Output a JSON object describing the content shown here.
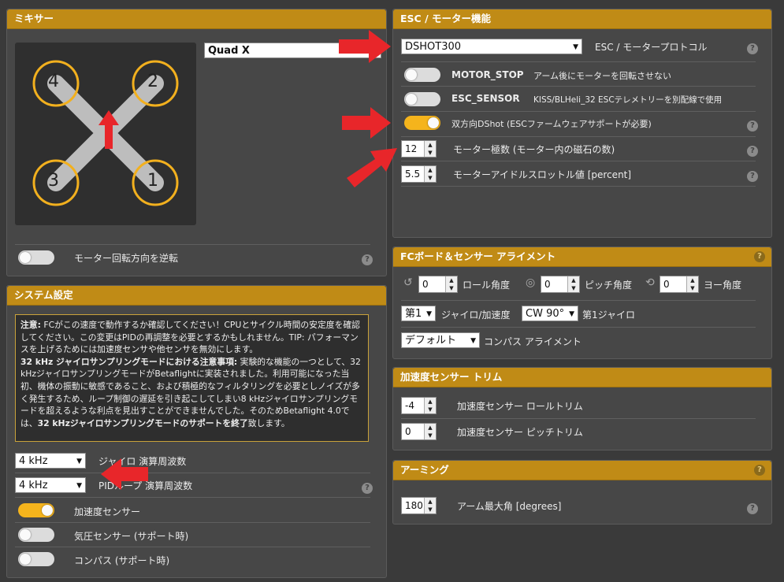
{
  "mixer": {
    "title": "ミキサー",
    "type": "Quad X",
    "reverse_label": "モーター回転方向を逆転",
    "motors": [
      "4",
      "2",
      "3",
      "1"
    ]
  },
  "esc": {
    "title": "ESC / モーター機能",
    "protocol": "DSHOT300",
    "protocol_label": "ESC / モータープロトコル",
    "motor_stop_name": "MOTOR_STOP",
    "motor_stop_desc": "アーム後にモーターを回転させない",
    "esc_sensor_name": "ESC_SENSOR",
    "esc_sensor_desc": "KISS/BLHeli_32 ESCテレメトリーを別配線で使用",
    "bidir_label": "双方向DShot (ESCファームウェアサポートが必要)",
    "poles_value": "12",
    "poles_label": "モーター極数 (モーター内の磁石の数)",
    "idle_value": "5.5",
    "idle_label": "モーターアイドルスロットル値 [percent]"
  },
  "align": {
    "title": "FCボード＆センサー アライメント",
    "roll_value": "0",
    "roll_label": "ロール角度",
    "pitch_value": "0",
    "pitch_label": "ピッチ角度",
    "yaw_value": "0",
    "yaw_label": "ヨー角度",
    "gyro_sel": "第1",
    "gyro_label": "ジャイロ/加速度",
    "gyro_align": "CW 90°",
    "gyro_name": "第1ジャイロ",
    "compass_sel": "デフォルト",
    "compass_label": "コンパス アライメント"
  },
  "acc_trim": {
    "title": "加速度センサー トリム",
    "roll_value": "-4",
    "roll_label": "加速度センサー ロールトリム",
    "pitch_value": "0",
    "pitch_label": "加速度センサー ピッチトリム"
  },
  "arming": {
    "title": "アーミング",
    "angle_value": "180",
    "angle_label": "アーム最大角 [degrees]"
  },
  "system": {
    "title": "システム設定",
    "warn1_head": "注意:",
    "warn1": " FCがこの速度で動作するか確認してください！CPUとサイクル時間の安定度を確認してください。この変更はPIDの再調整を必要とするかもしれません。TIP: パフォーマンスを上げるためには加速度センサや他センサを無効にします。",
    "warn2_head": "32 kHz ジャイロサンプリングモードにおける注意事項:",
    "warn2": " 実験的な機能の一つとして、32 kHzジャイロサンプリングモードがBetaflightに実装されました。利用可能になった当初、機体の振動に敏感であること、および積極的なフィルタリングを必要としノイズが多く発生するため、ループ制御の遅延を引き起こしてしまい8 kHzジャイロサンプリングモードを超えるような利点を見出すことができませんでした。そのためBetaflight 4.0では、",
    "warn2_tail": "32 kHzジャイロサンプリングモードのサポートを終了",
    "warn2_end": "致します。",
    "gyro_freq": "4 kHz",
    "gyro_freq_label": "ジャイロ 演算周波数",
    "pid_freq": "4 kHz",
    "pid_freq_label": "PIDループ 演算周波数",
    "acc_label": "加速度センサー",
    "baro_label": "気圧センサー (サポート時)",
    "mag_label": "コンパス (サポート時)"
  },
  "help_glyph": "?",
  "colors": {
    "accent": "#f5b41c",
    "header": "#c08b16",
    "arrow": "#e8262a"
  }
}
